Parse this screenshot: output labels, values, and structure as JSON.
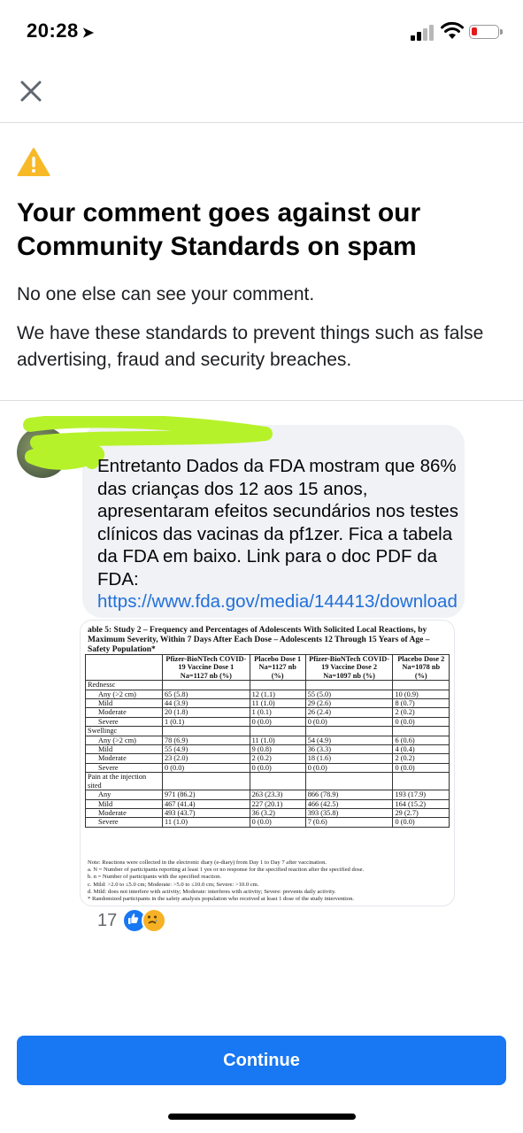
{
  "status_bar": {
    "time": "20:28"
  },
  "dialog": {
    "title": "Your comment goes against our Community Standards on spam",
    "line1": "No one else can see your comment.",
    "line2": "We have these standards to prevent things such as false advertising, fraud and security breaches."
  },
  "comment": {
    "text": "Entretanto Dados da FDA mostram que 86% das crianças dos 12 aos 15 anos, apresentaram efeitos secundários nos testes clínicos das vacinas da pf1zer. Fica a tabela da FDA em baixo. Link para o doc PDF da FDA: ",
    "link": "https://www.fda.gov/media/144413/download",
    "reaction_count": "17"
  },
  "attachment": {
    "caption": "able 5:   Study 2 – Frequency and Percentages of Adolescents With Solicited Local Reactions, by Maximum Severity, Within 7 Days After Each Dose – Adolescents 12 Through 15 Years of Age – Safety Population*",
    "headers": [
      "",
      "Pfizer-BioNTech COVID-19 Vaccine Dose 1 Na=1127 nb (%)",
      "Placebo Dose 1 Na=1127 nb (%)",
      "Pfizer-BioNTech COVID-19 Vaccine Dose 2 Na=1097 nb (%)",
      "Placebo Dose 2 Na=1078 nb (%)"
    ],
    "rows": [
      {
        "label": "Rednessc",
        "cells": [
          "",
          "",
          "",
          ""
        ],
        "group": true
      },
      {
        "label": "Any (>2 cm)",
        "cells": [
          "65 (5.8)",
          "12 (1.1)",
          "55 (5.0)",
          "10 (0.9)"
        ]
      },
      {
        "label": "Mild",
        "cells": [
          "44 (3.9)",
          "11 (1.0)",
          "29 (2.6)",
          "8 (0.7)"
        ]
      },
      {
        "label": "Moderate",
        "cells": [
          "20 (1.8)",
          "1 (0.1)",
          "26 (2.4)",
          "2 (0.2)"
        ]
      },
      {
        "label": "Severe",
        "cells": [
          "1 (0.1)",
          "0 (0.0)",
          "0 (0.0)",
          "0 (0.0)"
        ]
      },
      {
        "label": "Swellingc",
        "cells": [
          "",
          "",
          "",
          ""
        ],
        "group": true
      },
      {
        "label": "Any (>2 cm)",
        "cells": [
          "78 (6.9)",
          "11 (1.0)",
          "54 (4.9)",
          "6 (0.6)"
        ]
      },
      {
        "label": "Mild",
        "cells": [
          "55 (4.9)",
          "9 (0.8)",
          "36 (3.3)",
          "4 (0.4)"
        ]
      },
      {
        "label": "Moderate",
        "cells": [
          "23 (2.0)",
          "2 (0.2)",
          "18 (1.6)",
          "2 (0.2)"
        ]
      },
      {
        "label": "Severe",
        "cells": [
          "0 (0.0)",
          "0 (0.0)",
          "0 (0.0)",
          "0 (0.0)"
        ]
      },
      {
        "label": "Pain at the injection sited",
        "cells": [
          "",
          "",
          "",
          ""
        ],
        "group": true
      },
      {
        "label": "Any",
        "cells": [
          "971 (86.2)",
          "263 (23.3)",
          "866 (78.9)",
          "193 (17.9)"
        ]
      },
      {
        "label": "Mild",
        "cells": [
          "467 (41.4)",
          "227 (20.1)",
          "466 (42.5)",
          "164 (15.2)"
        ]
      },
      {
        "label": "Moderate",
        "cells": [
          "493 (43.7)",
          "36 (3.2)",
          "393 (35.8)",
          "29 (2.7)"
        ]
      },
      {
        "label": "Severe",
        "cells": [
          "11 (1.0)",
          "0 (0.0)",
          "7 (0.6)",
          "0 (0.0)"
        ]
      }
    ],
    "notes": [
      "Note: Reactions were collected in the electronic diary (e-diary) from Day 1 to Day 7 after vaccination.",
      "a. N = Number of participants reporting at least 1 yes or no response for the specified reaction after the specified dose.",
      "b. n = Number of participants with the specified reaction.",
      "c. Mild: >2.0 to ≤5.0 cm; Moderate: >5.0 to ≤10.0 cm; Severe: >10.0 cm.",
      "d. Mild: does not interfere with activity; Moderate: interferes with activity; Severe: prevents daily activity.",
      "* Randomized participants in the safety analysis population who received at least 1 dose of the study intervention."
    ]
  },
  "footer": {
    "continue_label": "Continue"
  },
  "colors": {
    "accent": "#1877f2",
    "link": "#216fdb",
    "warning": "#f7b928",
    "bubble": "#f0f2f5"
  }
}
